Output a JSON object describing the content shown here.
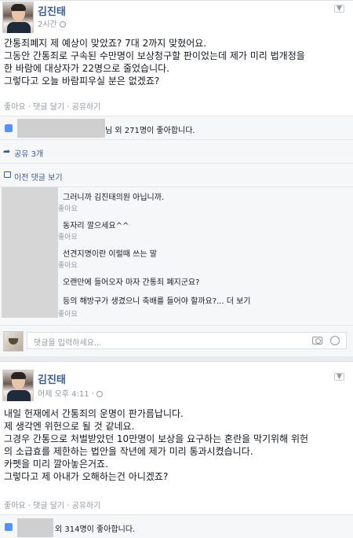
{
  "post1": {
    "author": "김진태",
    "time": "2시간",
    "body": "간통죄폐지 제 예상이 맞았죠? 7대 2까지 맞혔어요.\n그동안 간통죄로 구속된 수만명이 보상청구할 판이었는데 제가 미리 법개정을\n한 바람에 대상자가 22명으로 줄었습니다.\n그렇다고 오늘 바람피우실 분은 없겠죠?",
    "actions": "좋아요 · 댓글 달기 · 공유하기",
    "likes": "님 외 271명이 좋아합니다.",
    "shares": "공유 3개",
    "prev_comments": "이전 댓글 보기",
    "comments": [
      {
        "text": "그러니까 김진태의원 아닙니까.",
        "meta": "좋아요"
      },
      {
        "text": "동자리 깔으세요^^",
        "meta": "좋아요"
      },
      {
        "text": "선견지명이란 이럴때 쓰는 말",
        "meta": "좋아요"
      },
      {
        "text": "오랜만에 들어오자 마자 간통죄 폐지군요?",
        "meta": "좋아요"
      },
      {
        "text": "등의 해방구가 생겼으니 축배를 들어야 할까요?... 더 보기",
        "meta": "좋아요"
      }
    ],
    "comment_placeholder": "댓글을 입력하세요..."
  },
  "post2": {
    "author": "김진태",
    "time": "어제 오후 4:11 ·",
    "body": "내일 헌재에서 간통죄의 운명이 판가름납니다.\n제 생각엔 위헌으로 될 것 같네요.\n그경우 간통으로 처벌받았던 10만명이 보상을 요구하는 혼란을 막기위해 위헌\n의 소급효를 제한하는 법안을 작년에 제가 미리 통과시켰습니다.\n카펫을 미리 깔아놓은거죠.\n그렇다고 제 아내가 오해하는건 아니겠죠?",
    "actions": "좋아요 · 댓글 달기 · 공유하기",
    "likes": "외 314명이 좋아합니다."
  }
}
